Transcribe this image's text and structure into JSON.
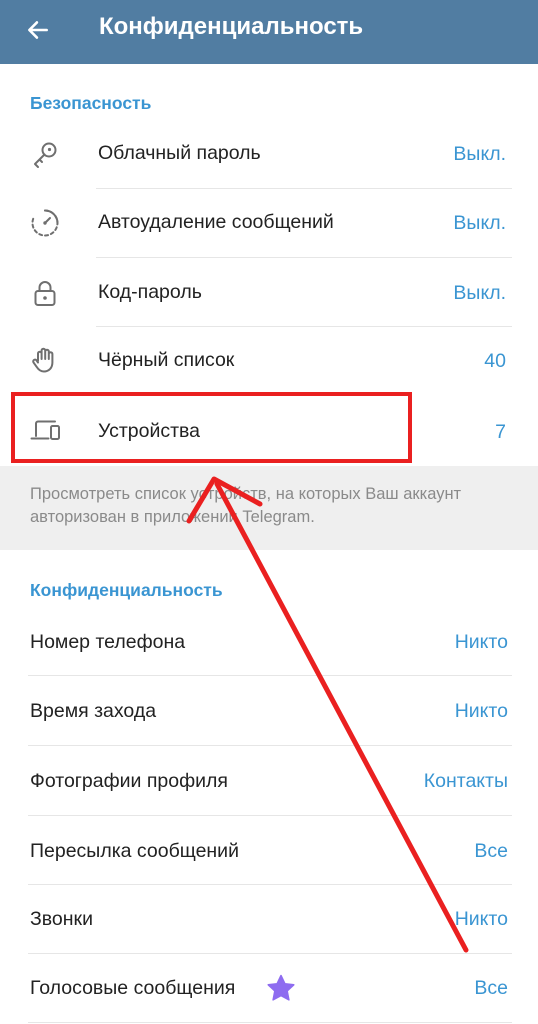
{
  "app_bar": {
    "title": "Конфиденциальность",
    "back_icon": "arrow-left-icon",
    "background": "#517da2"
  },
  "security": {
    "header": "Безопасность",
    "rows": [
      {
        "label": "Облачный пароль",
        "value": "Выкл.",
        "icon": "key-icon"
      },
      {
        "label": "Автоудаление сообщений",
        "value": "Выкл.",
        "icon": "timer-icon"
      },
      {
        "label": "Код-пароль",
        "value": "Выкл.",
        "icon": "lock-icon"
      },
      {
        "label": "Чёрный список",
        "value": "40",
        "icon": "hand-icon"
      },
      {
        "label": "Устройства",
        "value": "7",
        "icon": "devices-icon"
      }
    ],
    "footer": "Просмотреть список устройств, на которых Ваш аккаунт авторизован в приложении Telegram."
  },
  "privacy": {
    "header": "Конфиденциальность",
    "rows": [
      {
        "label": "Номер телефона",
        "value": "Никто"
      },
      {
        "label": "Время захода",
        "value": "Никто"
      },
      {
        "label": "Фотографии профиля",
        "value": "Контакты"
      },
      {
        "label": "Пересылка сообщений",
        "value": "Все"
      },
      {
        "label": "Звонки",
        "value": "Никто"
      },
      {
        "label": "Голосовые сообщения",
        "value": "Все",
        "badge_icon": "premium-star-icon"
      }
    ]
  },
  "colors": {
    "accent": "#3a95d2",
    "annotation": "#ea2020",
    "premium_star": "#8e6cf0"
  }
}
